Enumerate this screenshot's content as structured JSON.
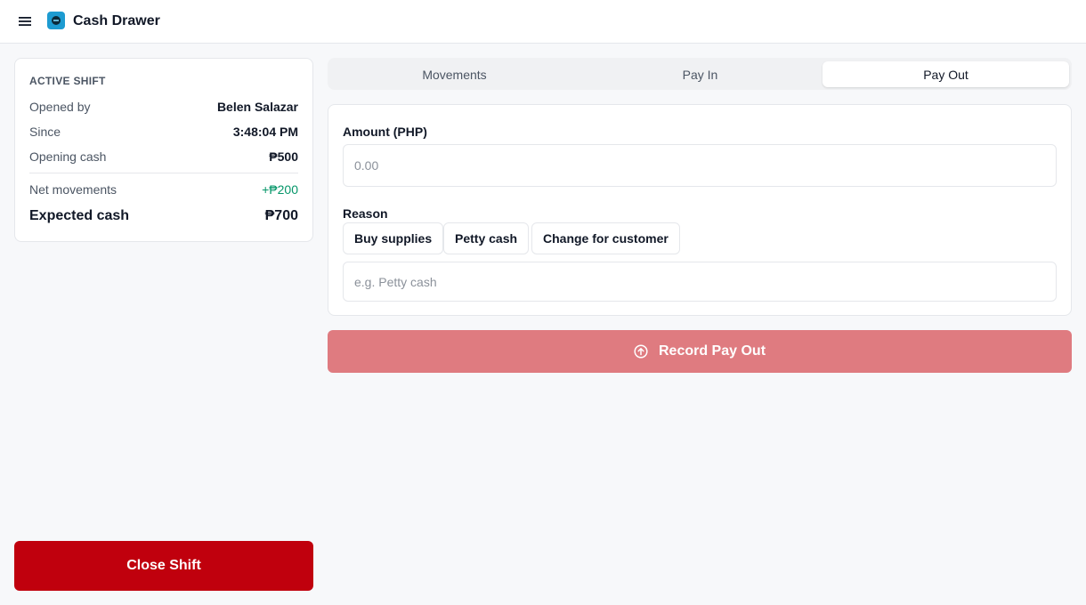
{
  "header": {
    "app_title": "Cash Drawer",
    "menu_icon": "hamburger-menu-icon",
    "logo_icon": "cash-drawer-logo-icon"
  },
  "shift": {
    "heading": "ACTIVE SHIFT",
    "opened_by_label": "Opened by",
    "opened_by_value": "Belen Salazar",
    "since_label": "Since",
    "since_value": "3:48:04 PM",
    "opening_cash_label": "Opening cash",
    "opening_cash_value": "₱500",
    "net_movements_label": "Net movements",
    "net_movements_value": "+₱200",
    "expected_cash_label": "Expected cash",
    "expected_cash_value": "₱700",
    "close_button": "Close Shift"
  },
  "tabs": {
    "items": [
      {
        "label": "Movements"
      },
      {
        "label": "Pay In"
      },
      {
        "label": "Pay Out"
      }
    ],
    "active": "Pay Out"
  },
  "form": {
    "amount_label": "Amount (PHP)",
    "amount_placeholder": "0.00",
    "amount_value": "",
    "reason_label": "Reason",
    "reason_chips": [
      {
        "label": "Buy supplies"
      },
      {
        "label": "Petty cash"
      },
      {
        "label": "Change for customer"
      }
    ],
    "reason_placeholder": "e.g. Petty cash",
    "reason_value": "",
    "submit_label": "Record Pay Out",
    "submit_icon": "arrow-up-circle-icon"
  },
  "colors": {
    "primary_danger": "#c0000d",
    "disabled_danger": "#df7b80",
    "positive": "#059669"
  }
}
